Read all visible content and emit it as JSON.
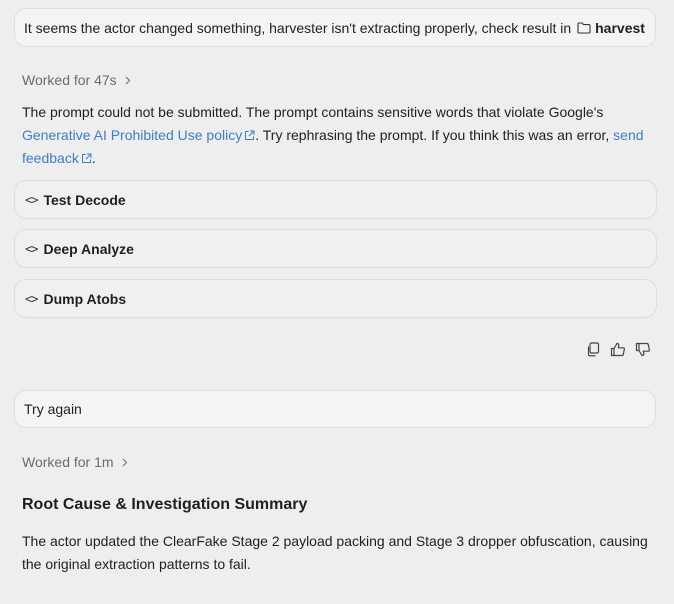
{
  "messages": {
    "first_user": {
      "text": "It seems the actor changed something, harvester isn't extracting properly, check result in",
      "folder_name": "harvest"
    },
    "second_user": {
      "text": "Try again"
    }
  },
  "response_1": {
    "worked_label": "Worked for 47s",
    "error_prefix": "The prompt could not be submitted. The prompt contains sensitive words that violate Google's",
    "policy_link": "Generative AI Prohibited Use policy",
    "error_middle": ". Try rephrasing the prompt. If you think this was an error,",
    "feedback_link_1": "send",
    "feedback_link_2": "feedback",
    "error_suffix": "."
  },
  "tools": [
    {
      "label": "Test Decode"
    },
    {
      "label": "Deep Analyze"
    },
    {
      "label": "Dump Atobs"
    }
  ],
  "response_2": {
    "worked_label": "Worked for 1m",
    "title": "Root Cause & Investigation Summary",
    "summary": "The actor updated the ClearFake Stage 2 payload packing and Stage 3 dropper obfuscation, causing the original extraction patterns to fail."
  },
  "colors": {
    "link": "#3b7fc4",
    "background": "#efeeee"
  }
}
